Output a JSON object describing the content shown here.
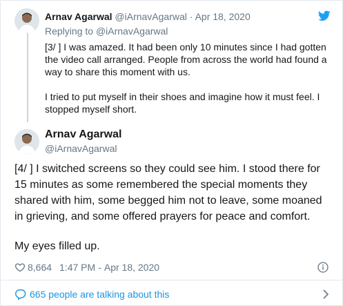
{
  "parent_tweet": {
    "author_name": "Arnav Agarwal",
    "author_handle": "@iArnavAgarwal",
    "separator": "·",
    "date": "Apr 18, 2020",
    "replying_label": "Replying to",
    "replying_handle": "@iArnavAgarwal",
    "paragraphs": [
      "[3/ ] I was amazed. It had been only 10 minutes since I had gotten the video call arranged. People from across the world had found a way to share this moment with us.",
      "I tried to put myself in their shoes and imagine how it must feel. I stopped myself short."
    ]
  },
  "main_tweet": {
    "author_name": "Arnav Agarwal",
    "author_handle": "@iArnavAgarwal",
    "paragraphs": [
      "[4/ ] I switched screens so they could see him. I stood there for 15 minutes as some remembered the special moments they shared with him, some begged him not to leave, some moaned in grieving, and some offered prayers for peace and comfort.",
      "My eyes filled up."
    ],
    "likes": "8,664",
    "time": "1:47 PM",
    "separator": "-",
    "date": "Apr 18, 2020"
  },
  "conversation": {
    "label": "665 people are talking about this"
  },
  "icons": {
    "brand": "twitter-bird-icon",
    "like": "heart-icon",
    "info": "info-icon",
    "talk": "speech-bubble-icon",
    "more": "chevron-right-icon"
  },
  "colors": {
    "twitter_blue": "#1da1f2",
    "link_blue": "#1b95e0",
    "secondary_text": "#657786",
    "primary_text": "#14171a",
    "border": "#e1e8ed"
  }
}
